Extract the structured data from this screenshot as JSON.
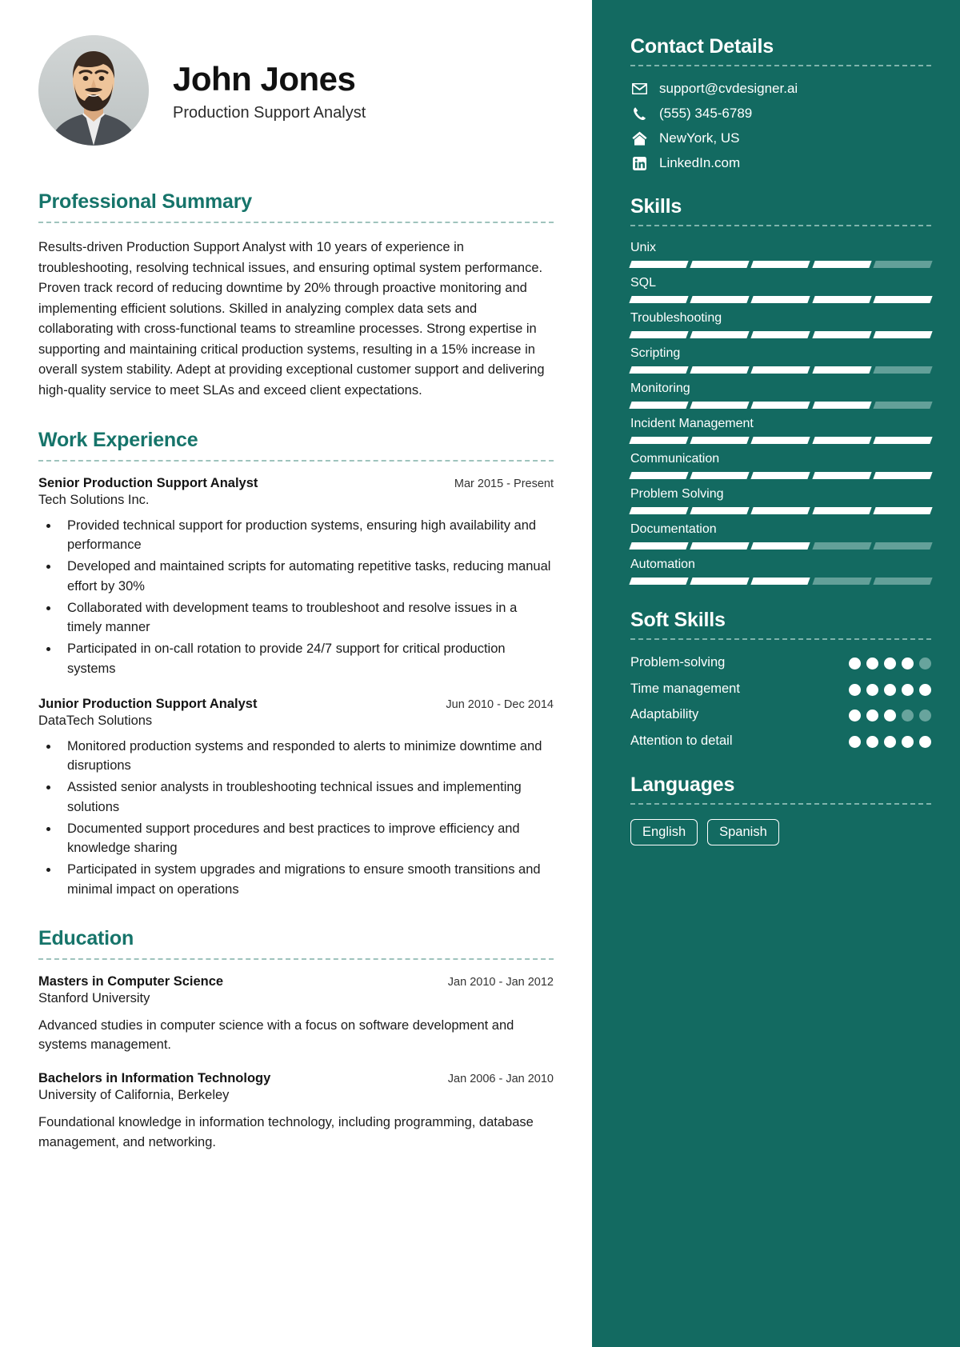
{
  "theme": {
    "accent": "#16746a",
    "sidebar_bg": "#136a61",
    "dim": "#63a099"
  },
  "header": {
    "name": "John Jones",
    "role": "Production Support Analyst",
    "avatar_alt": "profile-photo"
  },
  "summary": {
    "title": "Professional Summary",
    "text": "Results-driven Production Support Analyst with 10 years of experience in troubleshooting, resolving technical issues, and ensuring optimal system performance. Proven track record of reducing downtime by 20% through proactive monitoring and implementing efficient solutions. Skilled in analyzing complex data sets and collaborating with cross-functional teams to streamline processes. Strong expertise in supporting and maintaining critical production systems, resulting in a 15% increase in overall system stability. Adept at providing exceptional customer support and delivering high-quality service to meet SLAs and exceed client expectations."
  },
  "experience": {
    "title": "Work Experience",
    "jobs": [
      {
        "title": "Senior Production Support Analyst",
        "date": "Mar 2015 - Present",
        "org": "Tech Solutions Inc.",
        "bullets": [
          "Provided technical support for production systems, ensuring high availability and performance",
          "Developed and maintained scripts for automating repetitive tasks, reducing manual effort by 30%",
          "Collaborated with development teams to troubleshoot and resolve issues in a timely manner",
          "Participated in on-call rotation to provide 24/7 support for critical production systems"
        ]
      },
      {
        "title": "Junior Production Support Analyst",
        "date": "Jun 2010 - Dec 2014",
        "org": "DataTech Solutions",
        "bullets": [
          "Monitored production systems and responded to alerts to minimize downtime and disruptions",
          "Assisted senior analysts in troubleshooting technical issues and implementing solutions",
          "Documented support procedures and best practices to improve efficiency and knowledge sharing",
          "Participated in system upgrades and migrations to ensure smooth transitions and minimal impact on operations"
        ]
      }
    ]
  },
  "education": {
    "title": "Education",
    "items": [
      {
        "degree": "Masters in Computer Science",
        "date": "Jan 2010 - Jan 2012",
        "school": "Stanford University",
        "desc": "Advanced studies in computer science with a focus on software development and systems management."
      },
      {
        "degree": "Bachelors in Information Technology",
        "date": "Jan 2006 - Jan 2010",
        "school": "University of California, Berkeley",
        "desc": "Foundational knowledge in information technology, including programming, database management, and networking."
      }
    ]
  },
  "contact": {
    "title": "Contact Details",
    "items": [
      {
        "icon": "envelope-icon",
        "value": "support@cvdesigner.ai"
      },
      {
        "icon": "phone-icon",
        "value": "(555) 345-6789"
      },
      {
        "icon": "home-icon",
        "value": "NewYork, US"
      },
      {
        "icon": "linkedin-icon",
        "value": "LinkedIn.com"
      }
    ]
  },
  "skills": {
    "title": "Skills",
    "max": 5,
    "items": [
      {
        "name": "Unix",
        "level": 4
      },
      {
        "name": "SQL",
        "level": 5
      },
      {
        "name": "Troubleshooting",
        "level": 5
      },
      {
        "name": "Scripting",
        "level": 4
      },
      {
        "name": "Monitoring",
        "level": 4
      },
      {
        "name": "Incident Management",
        "level": 5
      },
      {
        "name": "Communication",
        "level": 5
      },
      {
        "name": "Problem Solving",
        "level": 5
      },
      {
        "name": "Documentation",
        "level": 3
      },
      {
        "name": "Automation",
        "level": 3
      }
    ]
  },
  "soft_skills": {
    "title": "Soft Skills",
    "max": 5,
    "items": [
      {
        "name": "Problem-solving",
        "level": 4
      },
      {
        "name": "Time management",
        "level": 5
      },
      {
        "name": "Adaptability",
        "level": 3
      },
      {
        "name": "Attention to detail",
        "level": 5
      }
    ]
  },
  "languages": {
    "title": "Languages",
    "items": [
      "English",
      "Spanish"
    ]
  }
}
